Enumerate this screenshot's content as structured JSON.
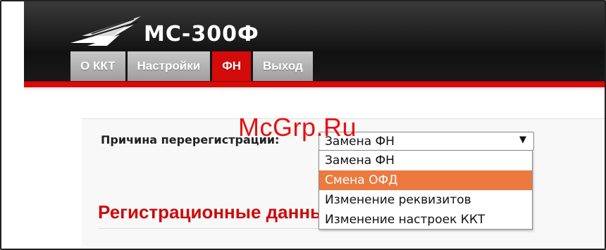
{
  "app": {
    "logo_text": "МС-300Ф"
  },
  "nav": {
    "tabs": [
      {
        "label": "О ККТ",
        "active": false
      },
      {
        "label": "Настройки",
        "active": false
      },
      {
        "label": "ФН",
        "active": true
      },
      {
        "label": "Выход",
        "active": false
      }
    ]
  },
  "form": {
    "reason_label": "Причина перерегистрации:",
    "selected_value": "Замена ФН",
    "options": [
      "Замена ФН",
      "Смена ОФД",
      "Изменение реквизитов",
      "Изменение настроек ККТ"
    ],
    "highlighted_option": "Смена ОФД"
  },
  "section": {
    "title": "Регистрационные данные"
  },
  "watermark": "McGrp.Ru",
  "colors": {
    "accent_red": "#d40b0b",
    "highlight_orange": "#ec7a40",
    "tab_grey": "#b0b0b0"
  },
  "icons": {
    "select_arrow": "▼"
  }
}
